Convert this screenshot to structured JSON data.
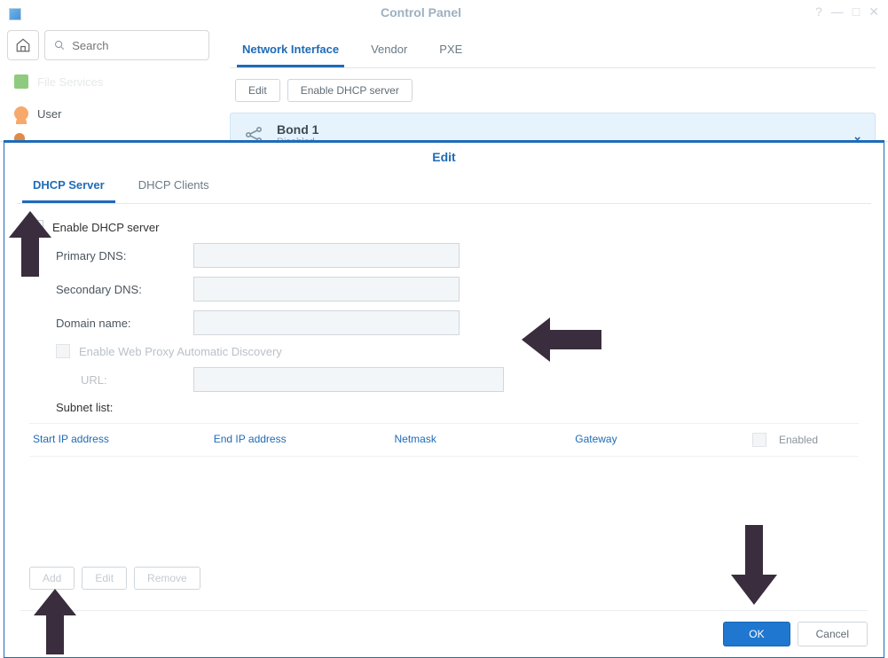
{
  "window": {
    "title": "Control Panel",
    "search_placeholder": "Search"
  },
  "sidebar": {
    "items": [
      {
        "label": "File Services"
      },
      {
        "label": "User"
      }
    ]
  },
  "main": {
    "tabs": [
      {
        "label": "Network Interface",
        "active": true
      },
      {
        "label": "Vendor"
      },
      {
        "label": "PXE"
      }
    ],
    "toolbar": {
      "edit": "Edit",
      "enable_dhcp": "Enable DHCP server"
    },
    "bond": {
      "name": "Bond 1",
      "status": "Disabled"
    }
  },
  "modal": {
    "title": "Edit",
    "tabs": [
      {
        "label": "DHCP Server",
        "active": true
      },
      {
        "label": "DHCP Clients"
      }
    ],
    "form": {
      "enable_dhcp_label": "Enable DHCP server",
      "primary_dns_label": "Primary DNS:",
      "secondary_dns_label": "Secondary DNS:",
      "domain_name_label": "Domain name:",
      "enable_wpad_label": "Enable Web Proxy Automatic Discovery",
      "url_label": "URL:",
      "subnet_list_label": "Subnet list:",
      "primary_dns": "",
      "secondary_dns": "",
      "domain_name": "",
      "url": ""
    },
    "subnet_table": {
      "cols": {
        "start_ip": "Start IP address",
        "end_ip": "End IP address",
        "netmask": "Netmask",
        "gateway": "Gateway",
        "enabled": "Enabled"
      }
    },
    "bottom_buttons": {
      "add": "Add",
      "edit": "Edit",
      "remove": "Remove"
    },
    "footer": {
      "ok": "OK",
      "cancel": "Cancel"
    }
  }
}
